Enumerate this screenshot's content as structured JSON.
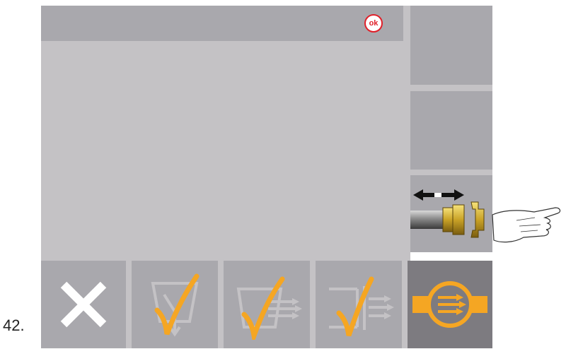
{
  "step": {
    "number": "42."
  },
  "header": {
    "ok_label": "ok"
  },
  "sidebar": {
    "buttons": [
      {
        "name": "side-button-1",
        "icon": ""
      },
      {
        "name": "side-button-2",
        "icon": ""
      },
      {
        "name": "side-button-coupling",
        "icon": "hose-coupling-icon"
      }
    ]
  },
  "toolbar": {
    "buttons": [
      {
        "name": "cancel-button",
        "icon": "close-icon"
      },
      {
        "name": "confirm-drain-button",
        "icon": "check-funnel-icon"
      },
      {
        "name": "confirm-fill-button",
        "icon": "check-tank-arrows-icon"
      },
      {
        "name": "confirm-flow-button",
        "icon": "check-wall-arrows-icon"
      },
      {
        "name": "flow-meter-button",
        "icon": "flow-meter-icon"
      }
    ]
  },
  "colors": {
    "accent": "#f5a623",
    "ok_red": "#e0202a",
    "panel": "#a9a8ad",
    "background": "#c4c2c5",
    "active": "#7d7b80"
  }
}
